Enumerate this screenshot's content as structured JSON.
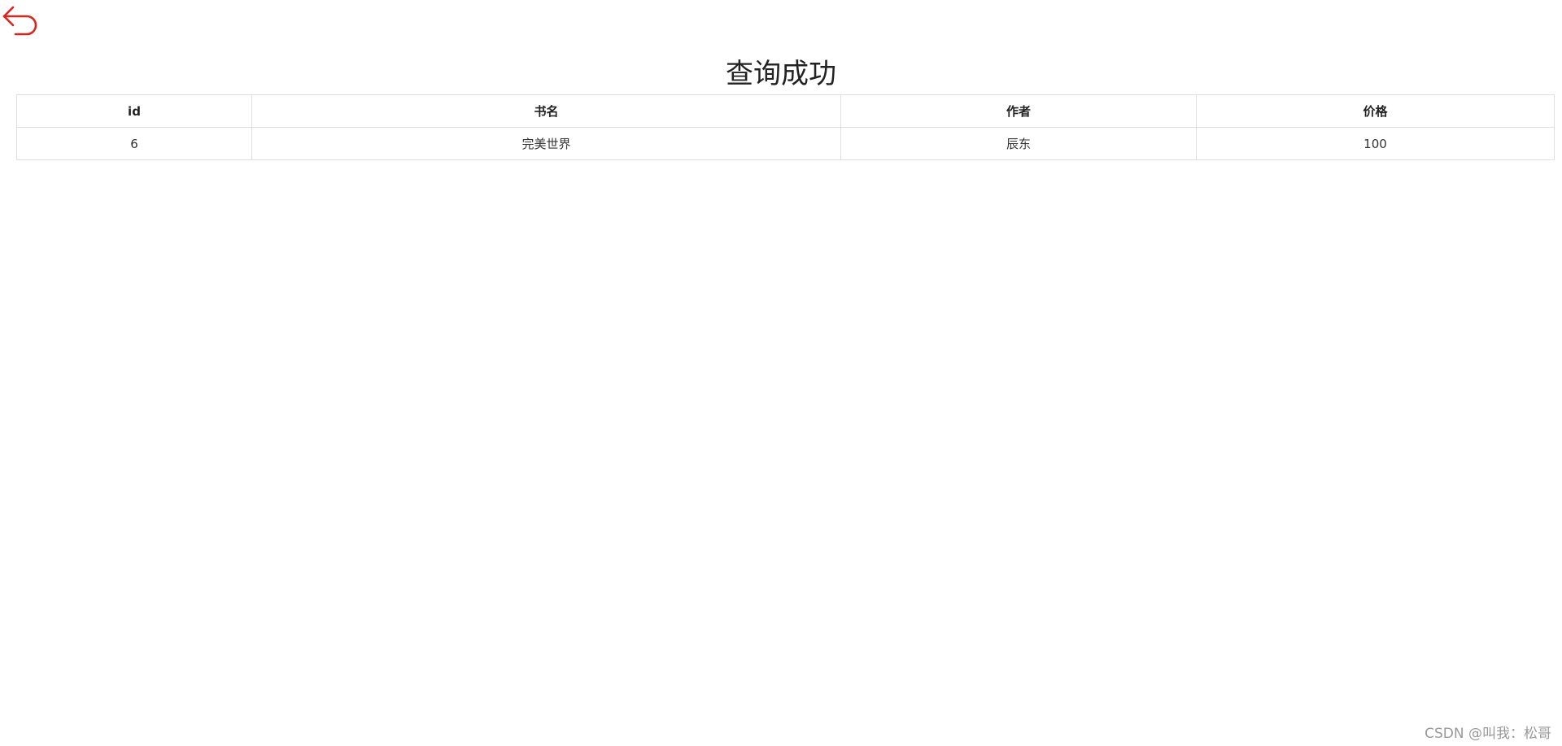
{
  "header": {
    "back_icon": "undo-arrow-icon",
    "back_icon_color": "#d9251c",
    "title": "查询成功"
  },
  "table": {
    "headers": [
      "id",
      "书名",
      "作者",
      "价格"
    ],
    "rows": [
      [
        "6",
        "完美世界",
        "辰东",
        "100"
      ]
    ]
  },
  "footer": {
    "watermark": "CSDN @叫我：松哥"
  }
}
